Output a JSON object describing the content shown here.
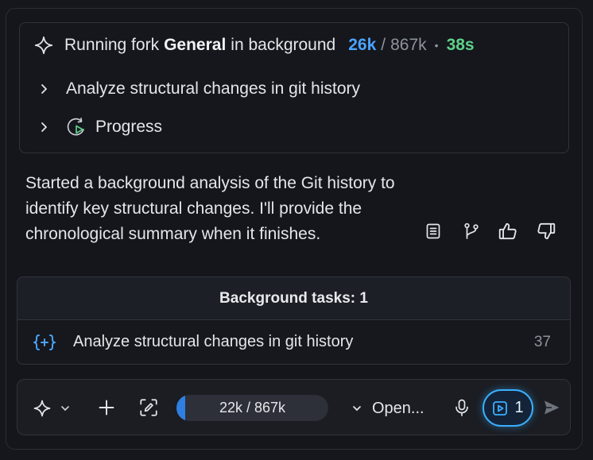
{
  "fork": {
    "prefix": "Running fork",
    "name": "General",
    "suffix": "in background",
    "tokens_used": "26k",
    "separator": "/",
    "tokens_total": "867k",
    "dot": "•",
    "elapsed": "38s"
  },
  "steps": [
    {
      "label": "Analyze structural changes in git history",
      "icon": "chevron-right-icon"
    },
    {
      "label": "Progress",
      "icon": "progress-play-icon"
    }
  ],
  "message": {
    "lines": [
      "Started a background analysis of the Git history to",
      "identify key structural changes. I'll provide the",
      "chronological summary when it finishes."
    ]
  },
  "message_actions": [
    "document-icon",
    "branch-icon",
    "thumbs-up-icon",
    "thumbs-down-icon"
  ],
  "background_tasks": {
    "title": "Background tasks: 1",
    "items": [
      {
        "icon": "braces-sparkle-icon",
        "label": "Analyze structural changes in git history",
        "count": "37"
      }
    ]
  },
  "composer": {
    "context_usage": "22k / 867k",
    "context_fraction": 0.06,
    "model_label": "Open...",
    "run_count": "1"
  },
  "colors": {
    "accent_blue": "#4aa3ff",
    "accent_green": "#5fd08a",
    "run_border": "#3ab0ff"
  }
}
